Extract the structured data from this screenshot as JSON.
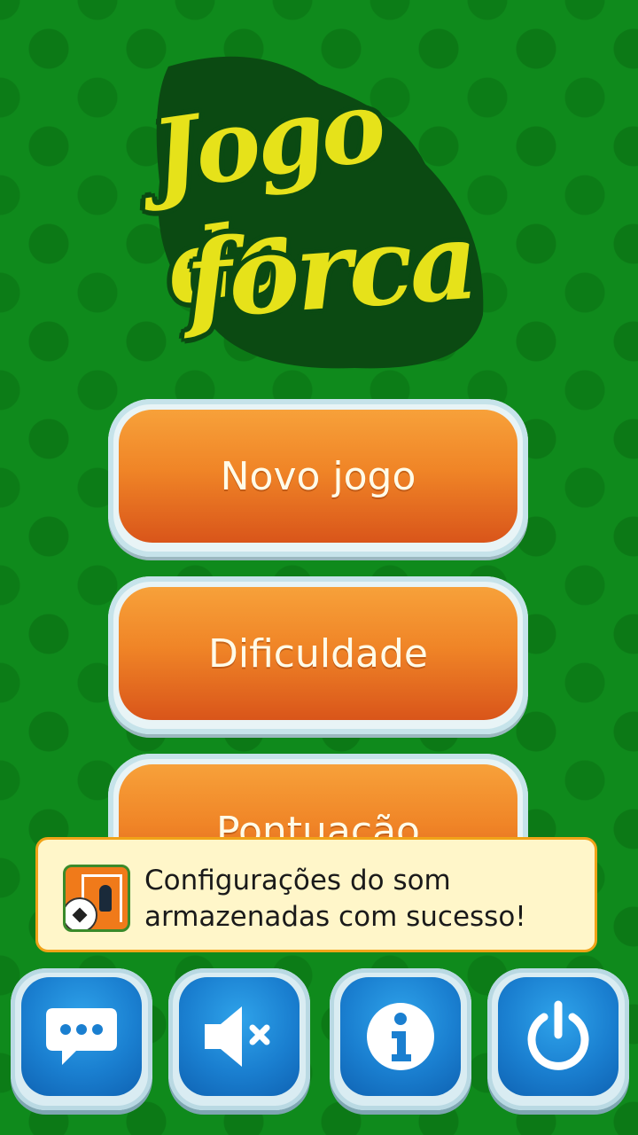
{
  "logo": {
    "line1": "Jogo da",
    "line2": "forca"
  },
  "menu": {
    "new_game": "Novo jogo",
    "difficulty": "Dificuldade",
    "score": "Pontuação"
  },
  "toast": {
    "message": "Configurações do som armazenadas com sucesso!",
    "icon": "app-icon"
  },
  "bottom_bar": [
    {
      "icon": "chat-bubble-icon"
    },
    {
      "icon": "sound-muted-icon"
    },
    {
      "icon": "info-icon"
    },
    {
      "icon": "power-icon"
    }
  ],
  "colors": {
    "background": "#0f8a1c",
    "logo_text": "#e6e21a",
    "menu_button": "#f08527",
    "toolbar_button": "#1a7fd0",
    "toast_background": "#fff6c9",
    "toast_border": "#f0a318"
  }
}
